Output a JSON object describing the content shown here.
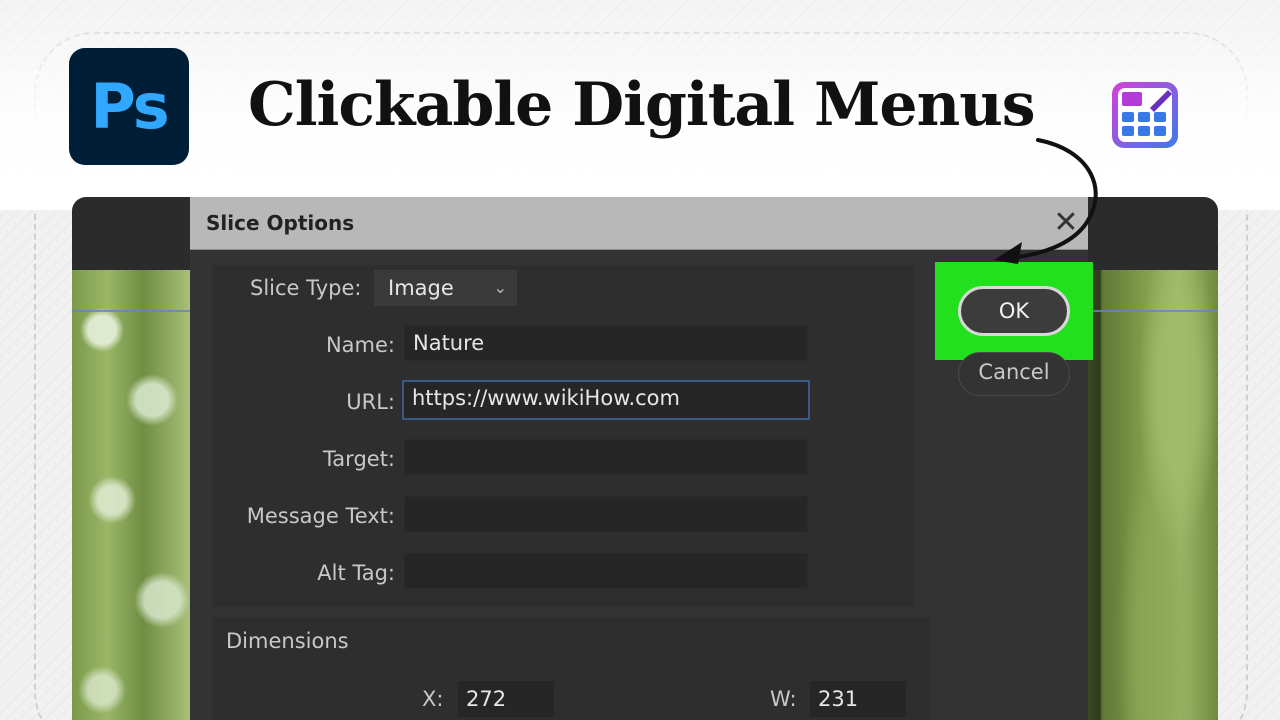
{
  "header": {
    "app_logo_text": "Ps",
    "title": "Clickable Digital Menus"
  },
  "dialog": {
    "title": "Slice Options",
    "slice_type_label": "Slice Type:",
    "slice_type_value": "Image",
    "fields": [
      {
        "label": "Name:",
        "value": "Nature"
      },
      {
        "label": "URL:",
        "value": "https://www.wikiHow.com"
      },
      {
        "label": "Target:",
        "value": ""
      },
      {
        "label": "Message Text:",
        "value": ""
      },
      {
        "label": "Alt Tag:",
        "value": ""
      }
    ],
    "dimensions": {
      "title": "Dimensions",
      "x_label": "X:",
      "x_value": "272",
      "w_label": "W:",
      "w_value": "231"
    },
    "ok_label": "OK",
    "cancel_label": "Cancel"
  },
  "colors": {
    "highlight": "#22e01e",
    "ps_blue": "#31a8ff",
    "ps_bg": "#001e36"
  },
  "icons": [
    "photoshop-logo-icon",
    "digital-menu-brand-icon",
    "close-icon",
    "chevron-down-icon",
    "curved-arrow-icon"
  ]
}
